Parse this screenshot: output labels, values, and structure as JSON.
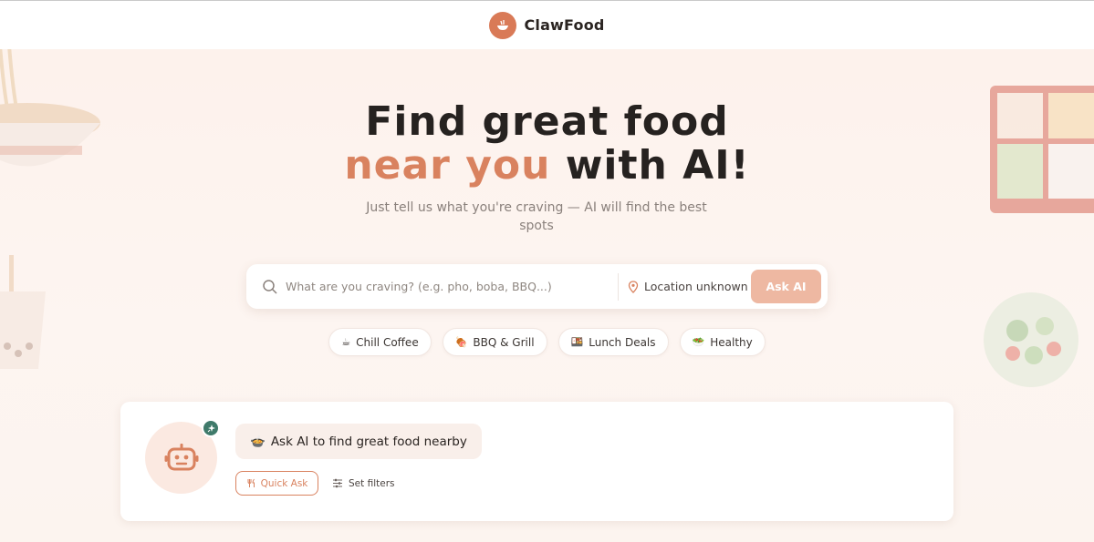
{
  "header": {
    "brand": "ClawFood"
  },
  "hero": {
    "line1": "Find great food",
    "line2_accent": "near you",
    "line2_rest": "with AI!",
    "subtitle": "Just tell us what you're craving — AI will find the best spots"
  },
  "search": {
    "placeholder": "What are you craving? (e.g. pho, boba, BBQ...)",
    "location": "Location unknown",
    "ask_label": "Ask AI"
  },
  "chips": [
    {
      "emoji": "☕",
      "label": "Chill Coffee"
    },
    {
      "emoji": "🍖",
      "label": "BBQ & Grill"
    },
    {
      "emoji": "🍱",
      "label": "Lunch Deals"
    },
    {
      "emoji": "🥗",
      "label": "Healthy"
    }
  ],
  "assistant": {
    "prompt_emoji": "🍲",
    "prompt": "Ask AI to find great food nearby",
    "quick_ask": "Quick Ask",
    "set_filters": "Set filters"
  },
  "colors": {
    "accent": "#d9825f",
    "ask_button": "#eeb8a2",
    "badge": "#3f7a6a"
  },
  "icons": [
    "bowl-logo-icon",
    "search-icon",
    "location-pin-icon",
    "robot-icon",
    "sparkle-icon",
    "utensils-icon",
    "sliders-icon"
  ]
}
